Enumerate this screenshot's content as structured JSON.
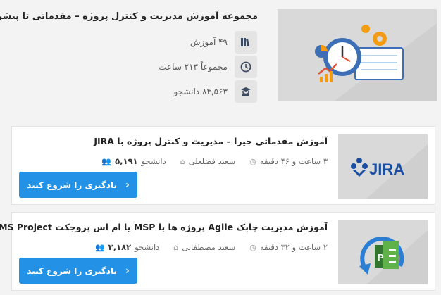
{
  "course": {
    "title": "مجموعه آموزش مدیریت و کنترل پروژه – مقدماتی تا پیشرفته",
    "lessons": "۴۹ آموزش",
    "duration": "مجموعاً ۲۱۳ ساعت",
    "students": "۸۴,۵۶۳ دانشجو",
    "icons": [
      "books-icon",
      "clock-icon",
      "graduate-icon"
    ]
  },
  "items": [
    {
      "title": "آموزش مقدماتی جیرا – مدیریت و کنترل پروژه با JIRA",
      "students": "۵,۱۹۱",
      "students_label": "دانشجو",
      "teacher": "سعید فضلعلی",
      "duration": "۳ ساعت و ۴۶ دقیقه",
      "button": "یادگیری را شروع کنید",
      "thumb_label": "JIRA"
    },
    {
      "title": "آموزش مدیریت چابک Agile پروژه ها با MSP یا ام اس پروجکت MS Project",
      "students": "۳,۱۸۲",
      "students_label": "دانشجو",
      "teacher": "سعید مصطفایی",
      "duration": "۲ ساعت و ۳۲ دقیقه",
      "button": "یادگیری را شروع کنید"
    }
  ],
  "colors": {
    "accent": "#2392e6",
    "jira_blue": "#1a4ea0"
  }
}
